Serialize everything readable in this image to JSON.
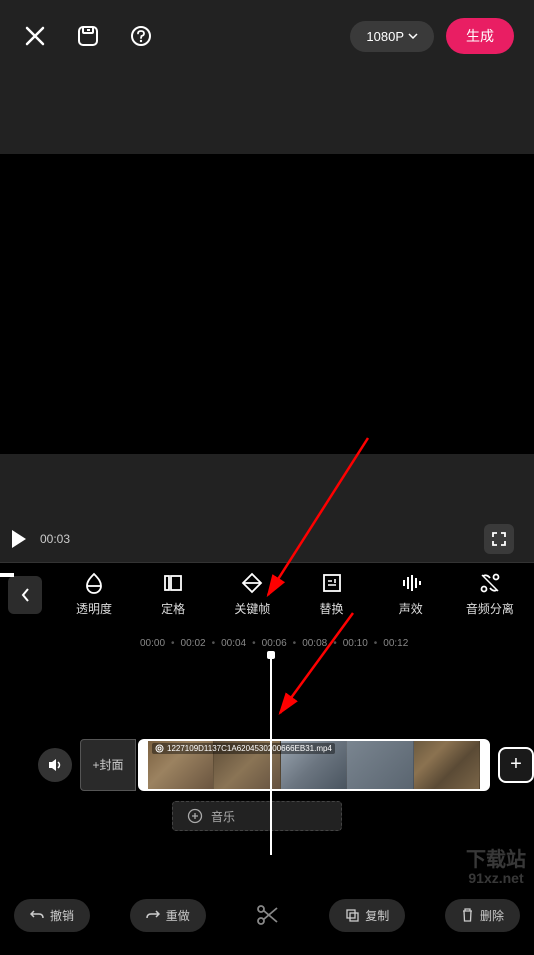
{
  "topbar": {
    "resolution": "1080P",
    "generate": "生成"
  },
  "playback": {
    "time": "00:03"
  },
  "tools": {
    "opacity": "透明度",
    "freeze": "定格",
    "keyframe": "关键帧",
    "replace": "替换",
    "soundfx": "声效",
    "audiodetach": "音频分离"
  },
  "ruler": {
    "t0": "00:00",
    "t1": "00:02",
    "t2": "00:04",
    "t3": "00:06",
    "t4": "00:08",
    "t5": "00:10",
    "t6": "00:12"
  },
  "timeline": {
    "cover": "+封面",
    "filename": "1227109D1137C1A6204530200666EB31.mp4",
    "music": "音乐"
  },
  "bottom": {
    "undo": "撤销",
    "redo": "重做",
    "copy": "复制",
    "delete": "删除"
  },
  "watermark": {
    "line1": "下载站",
    "line2": "91xz.net"
  }
}
